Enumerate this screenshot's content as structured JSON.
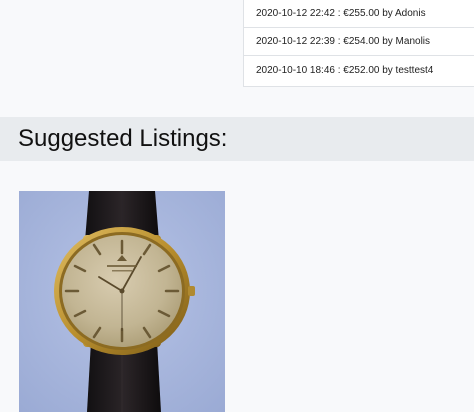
{
  "bids": [
    {
      "text": "2020-10-12 22:42 : €255.00 by Adonis"
    },
    {
      "text": "2020-10-12 22:39 : €254.00 by Manolis"
    },
    {
      "text": "2020-10-10 18:46 : €252.00 by testtest4"
    }
  ],
  "suggested": {
    "title": "Suggested Listings:",
    "listings": [
      {
        "image": "gold-wristwatch-image"
      }
    ]
  },
  "colors": {
    "header_bg": "#e8ebee",
    "page_bg": "#f8f9fb",
    "photo_bg": "#aab8de",
    "gold": "#c9a24a",
    "strap": "#1e1a1c"
  }
}
